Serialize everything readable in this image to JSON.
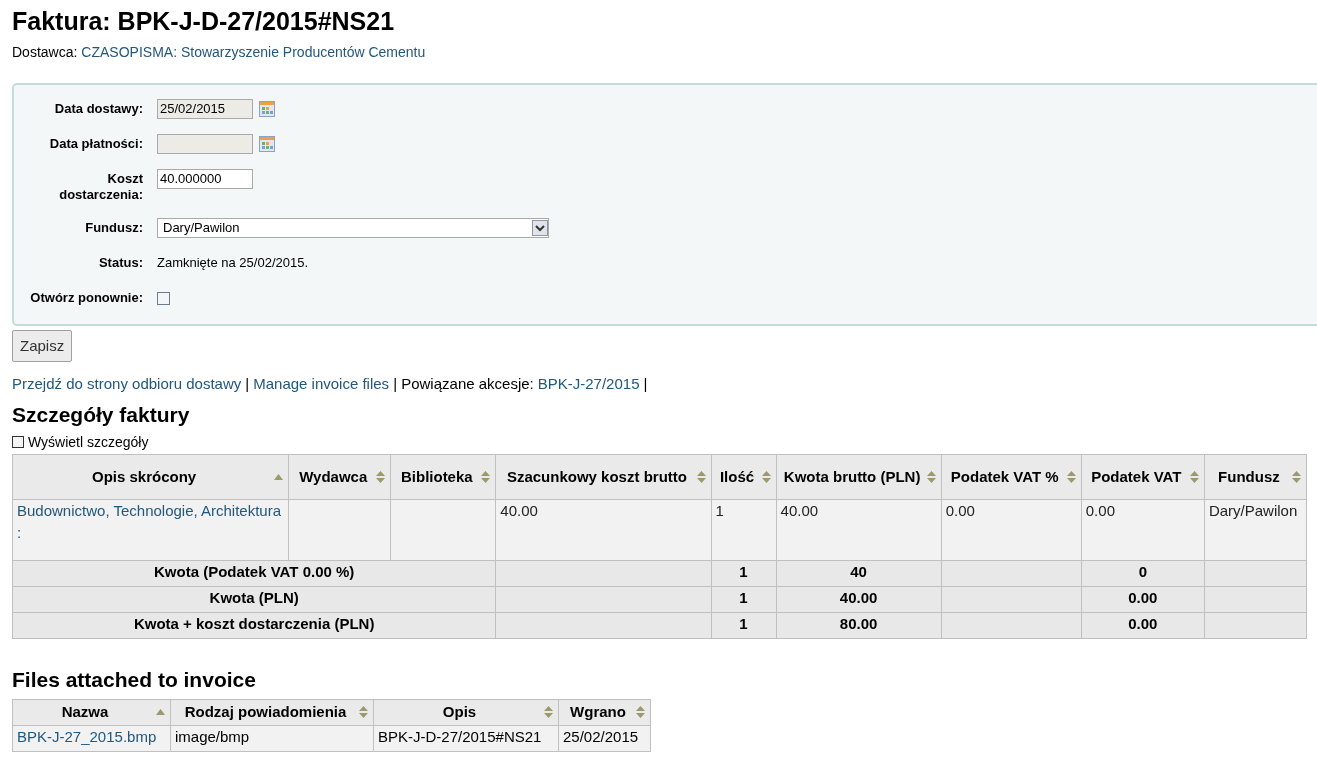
{
  "title": "Faktura: BPK-J-D-27/2015#NS21",
  "supplier": {
    "label": "Dostawca:",
    "link": "CZASOPISMA: Stowarzyszenie Producentów Cementu"
  },
  "form": [
    {
      "kind": "date",
      "label": "Data dostawy:",
      "value": "25/02/2015"
    },
    {
      "kind": "date",
      "label": "Data płatności:"
    },
    {
      "kind": "text",
      "label": "Koszt dostarczenia:",
      "value": "40.000000"
    },
    {
      "kind": "select",
      "label": "Fundusz:",
      "value": "Dary/Pawilon"
    },
    {
      "kind": "static",
      "label": "Status:",
      "value": "Zamknięte na 25/02/2015."
    },
    {
      "kind": "checkbox",
      "label": "Otwórz ponownie:",
      "checked": false
    }
  ],
  "save_button": "Zapisz",
  "links": [
    {
      "kind": "link",
      "text": "Przejdź do strony odbioru dostawy"
    },
    {
      "kind": "text",
      "text": "|"
    },
    {
      "kind": "link",
      "text": "Manage invoice files"
    },
    {
      "kind": "text",
      "text": "| Powiązane akcesje:"
    },
    {
      "kind": "link",
      "text": "BPK-J-27/2015"
    },
    {
      "kind": "text",
      "text": "|"
    }
  ],
  "details": {
    "title": "Szczegóły faktury",
    "toggle": {
      "label": "Wyświetl szczegóły",
      "checked": false
    },
    "columns": [
      {
        "label": "Opis skrócony",
        "sorted_ascending": true
      },
      {
        "label": "Wydawca",
        "sorted_ascending": false
      },
      {
        "label": "Biblioteka",
        "sorted_ascending": false
      },
      {
        "label": "Szacunkowy koszt brutto",
        "sorted_ascending": false
      },
      {
        "label": "Ilość",
        "sorted_ascending": false
      },
      {
        "label": "Kwota brutto (PLN)",
        "sorted_ascending": false
      },
      {
        "label": "Podatek VAT %",
        "sorted_ascending": false
      },
      {
        "label": "Podatek VAT",
        "sorted_ascending": false
      },
      {
        "label": "Fundusz",
        "sorted_ascending": false
      }
    ],
    "rows": [
      {
        "cells": [
          "Budownictwo, Technologie, Architektura :",
          "",
          "",
          "40.00",
          "1",
          "40.00",
          "0.00",
          "0.00",
          "Dary/Pawilon"
        ]
      }
    ],
    "totals": [
      {
        "label": "Kwota (Podatek VAT 0.00 %)",
        "quantity": "1",
        "gross": "40",
        "vat": "0"
      },
      {
        "label": "Kwota (PLN)",
        "quantity": "1",
        "gross": "40.00",
        "vat": "0.00"
      },
      {
        "label": "Kwota + koszt dostarczenia (PLN)",
        "quantity": "1",
        "gross": "80.00",
        "vat": "0.00"
      }
    ]
  },
  "files": {
    "title": "Files attached to invoice",
    "columns": [
      {
        "label": "Nazwa",
        "sorted_ascending": true
      },
      {
        "label": "Rodzaj powiadomienia",
        "sorted_ascending": false
      },
      {
        "label": "Opis",
        "sorted_ascending": false
      },
      {
        "label": "Wgrano",
        "sorted_ascending": false
      }
    ],
    "rows": [
      {
        "name": "BPK-J-27_2015.bmp",
        "type": "image/bmp",
        "description": "BPK-J-D-27/2015#NS21",
        "uploaded": "25/02/2015"
      }
    ]
  }
}
